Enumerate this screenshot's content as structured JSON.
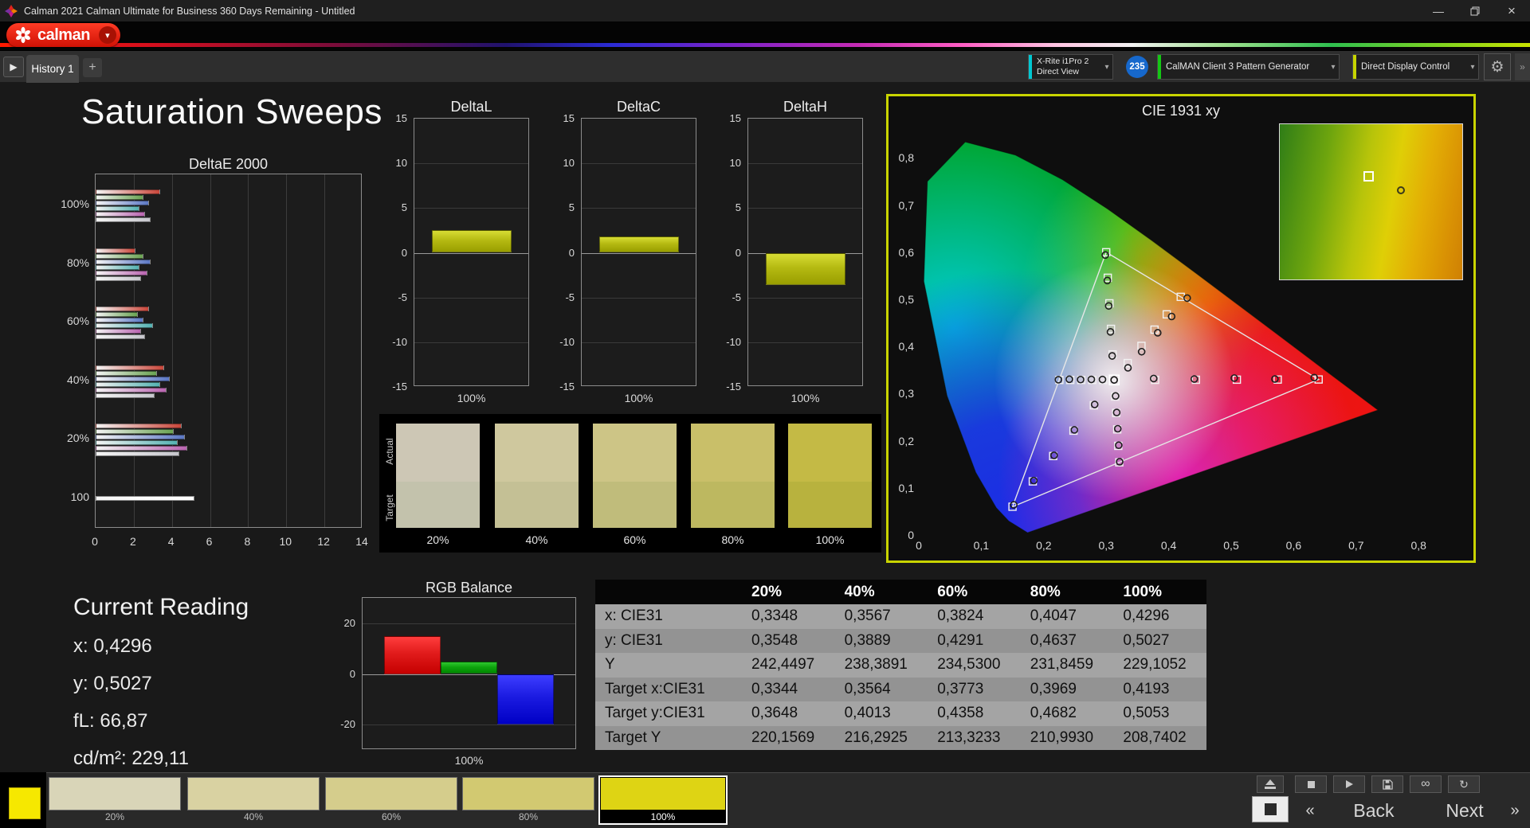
{
  "window": {
    "title": "Calman 2021 Calman Ultimate for Business 360 Days Remaining  - Untitled"
  },
  "brand": {
    "logo_text": "calman"
  },
  "tabs": {
    "history_tab": "History 1",
    "add_tab": "+"
  },
  "toolbar": {
    "meter_line1": "X-Rite i1Pro 2",
    "meter_line2": "Direct View",
    "meter_badge": "235",
    "source": "CalMAN Client 3 Pattern Generator",
    "display_control": "Direct Display Control"
  },
  "page": {
    "title": "Saturation Sweeps"
  },
  "current_reading": {
    "heading": "Current Reading",
    "x": "x: 0,4296",
    "y": "y: 0,5027",
    "fl": "fL: 66,87",
    "cdm2": "cd/m²: 229,11"
  },
  "swatch_panel": {
    "actual_label": "Actual",
    "target_label": "Target",
    "columns": [
      {
        "label": "20%",
        "actual": "#cdc7b5",
        "target": "#c3c2ac"
      },
      {
        "label": "40%",
        "actual": "#cfc89e",
        "target": "#c4c095"
      },
      {
        "label": "60%",
        "actual": "#cdc586",
        "target": "#c0bc7b"
      },
      {
        "label": "80%",
        "actual": "#c9bf69",
        "target": "#bdb860"
      },
      {
        "label": "100%",
        "actual": "#c4ba45",
        "target": "#b8b23e"
      }
    ]
  },
  "table": {
    "col_headers": [
      "20%",
      "40%",
      "60%",
      "80%",
      "100%"
    ],
    "rows": [
      {
        "label": "x: CIE31",
        "values": [
          "0,3348",
          "0,3567",
          "0,3824",
          "0,4047",
          "0,4296"
        ]
      },
      {
        "label": "y: CIE31",
        "values": [
          "0,3548",
          "0,3889",
          "0,4291",
          "0,4637",
          "0,5027"
        ]
      },
      {
        "label": "Y",
        "values": [
          "242,4497",
          "238,3891",
          "234,5300",
          "231,8459",
          "229,1052"
        ]
      },
      {
        "label": "Target x:CIE31",
        "values": [
          "0,3344",
          "0,3564",
          "0,3773",
          "0,3969",
          "0,4193"
        ]
      },
      {
        "label": "Target y:CIE31",
        "values": [
          "0,3648",
          "0,4013",
          "0,4358",
          "0,4682",
          "0,5053"
        ]
      },
      {
        "label": "Target Y",
        "values": [
          "220,1569",
          "216,2925",
          "213,3233",
          "210,9930",
          "208,7402"
        ]
      }
    ]
  },
  "bottom_bar": {
    "pattern_color": "#f6e800",
    "swatches": [
      {
        "label": "20%",
        "color": "#d9d5b8"
      },
      {
        "label": "40%",
        "color": "#d9d2a2"
      },
      {
        "label": "60%",
        "color": "#d5cd8c"
      },
      {
        "label": "80%",
        "color": "#d2c971"
      },
      {
        "label": "100%",
        "color": "#ded414"
      }
    ],
    "selected_index": 4,
    "back": "Back",
    "next": "Next"
  },
  "icons": {
    "app": "pinwheel-svg",
    "logo_flower": "flower-svg",
    "dropdown_caret": "▾",
    "minimize": "—",
    "maximize": "restore-squares-svg",
    "close": "×",
    "history_play": "▶",
    "add": "+",
    "gear": "⚙",
    "panel_expand": "»",
    "eject": "css-shape",
    "stop": "css-shape",
    "play": "css-shape",
    "save": "floppy-svg",
    "infinity": "∞",
    "repeat": "↻",
    "prev_chevrons": "«",
    "next_chevrons": "»"
  },
  "chart_data": [
    {
      "id": "deltae2000",
      "type": "bar",
      "orientation": "horizontal",
      "title": "DeltaE 2000",
      "categories": [
        "100%",
        "80%",
        "60%",
        "40%",
        "20%",
        "100"
      ],
      "colors": [
        "#c9463a",
        "#6aa352",
        "#5b77c4",
        "#54b2b2",
        "#b964b0",
        "#c6c6cc"
      ],
      "groups": [
        [
          3.4,
          2.5,
          2.8,
          2.3,
          2.6,
          2.9
        ],
        [
          2.1,
          2.5,
          2.9,
          2.3,
          2.7,
          2.4
        ],
        [
          2.8,
          2.2,
          2.5,
          3.0,
          2.4,
          2.6
        ],
        [
          3.6,
          3.2,
          3.9,
          3.4,
          3.7,
          3.1
        ],
        [
          4.5,
          4.1,
          4.7,
          4.3,
          4.8,
          4.4
        ],
        [
          5.2
        ]
      ],
      "xlim": [
        0,
        14
      ],
      "xticks": [
        0,
        2,
        4,
        6,
        8,
        10,
        12,
        14
      ],
      "grid": true
    },
    {
      "id": "deltaL",
      "type": "bar",
      "title": "DeltaL",
      "categories": [
        "100%"
      ],
      "values": [
        2.5
      ],
      "ylim": [
        -15,
        15
      ],
      "yticks": [
        15,
        10,
        5,
        0,
        -5,
        -10,
        -15
      ],
      "bar_color": "#b5ba12",
      "xlabel": "100%"
    },
    {
      "id": "deltaC",
      "type": "bar",
      "title": "DeltaC",
      "categories": [
        "100%"
      ],
      "values": [
        1.8
      ],
      "ylim": [
        -15,
        15
      ],
      "yticks": [
        15,
        10,
        5,
        0,
        -5,
        -10,
        -15
      ],
      "bar_color": "#b5ba12",
      "xlabel": "100%"
    },
    {
      "id": "deltaH",
      "type": "bar",
      "title": "DeltaH",
      "categories": [
        "100%"
      ],
      "values": [
        -3.6
      ],
      "ylim": [
        -15,
        15
      ],
      "yticks": [
        15,
        10,
        5,
        0,
        -5,
        -10,
        -15
      ],
      "bar_color": "#b5ba12",
      "xlabel": "100%"
    },
    {
      "id": "rgb_balance",
      "type": "bar",
      "title": "RGB Balance",
      "categories": [
        "Red",
        "Green",
        "Blue"
      ],
      "values": [
        15,
        5,
        -20
      ],
      "colors": [
        "#e11b1b",
        "#0ea50e",
        "#1b1be1"
      ],
      "ylim": [
        -30,
        30
      ],
      "yticks": [
        20,
        0,
        -20
      ],
      "xlabel": "100%"
    },
    {
      "id": "cie1931",
      "type": "scatter",
      "title": "CIE 1931 xy",
      "xlim": [
        0,
        0.8
      ],
      "ylim": [
        0,
        0.8
      ],
      "xtick_labels": [
        "0",
        "0,1",
        "0,2",
        "0,3",
        "0,4",
        "0,5",
        "0,6",
        "0,7",
        "0,8"
      ],
      "ytick_labels": [
        "0",
        "0,1",
        "0,2",
        "0,3",
        "0,4",
        "0,5",
        "0,6",
        "0,7",
        "0,8"
      ],
      "gamut_triangle": {
        "red": [
          0.64,
          0.33
        ],
        "green": [
          0.3,
          0.6
        ],
        "blue": [
          0.15,
          0.06
        ]
      },
      "white_point": [
        0.3127,
        0.329
      ],
      "sweeps": [
        {
          "name": "red",
          "target": [
            [
              0.3782,
              0.3292
            ],
            [
              0.4436,
              0.3294
            ],
            [
              0.5091,
              0.3296
            ],
            [
              0.5745,
              0.3298
            ],
            [
              0.64,
              0.33
            ]
          ],
          "measured": [
            [
              0.376,
              0.332
            ],
            [
              0.441,
              0.331
            ],
            [
              0.505,
              0.333
            ],
            [
              0.57,
              0.331
            ],
            [
              0.633,
              0.334
            ]
          ]
        },
        {
          "name": "green",
          "target": [
            [
              0.3102,
              0.3832
            ],
            [
              0.3076,
              0.4374
            ],
            [
              0.3051,
              0.4916
            ],
            [
              0.3025,
              0.5458
            ],
            [
              0.3,
              0.6
            ]
          ],
          "measured": [
            [
              0.3095,
              0.38
            ],
            [
              0.3068,
              0.431
            ],
            [
              0.304,
              0.486
            ],
            [
              0.3018,
              0.54
            ],
            [
              0.2985,
              0.594
            ]
          ]
        },
        {
          "name": "blue",
          "target": [
            [
              0.2802,
              0.2752
            ],
            [
              0.2476,
              0.2214
            ],
            [
              0.2151,
              0.1676
            ],
            [
              0.1825,
              0.1138
            ],
            [
              0.15,
              0.06
            ]
          ],
          "measured": [
            [
              0.2815,
              0.277
            ],
            [
              0.249,
              0.223
            ],
            [
              0.2165,
              0.169
            ],
            [
              0.184,
              0.1155
            ],
            [
              0.152,
              0.064
            ]
          ]
        },
        {
          "name": "cyan",
          "target": [
            [
              0.2952,
              0.329
            ],
            [
              0.2776,
              0.329
            ],
            [
              0.2601,
              0.329
            ],
            [
              0.2425,
              0.329
            ],
            [
              0.225,
              0.329
            ]
          ],
          "measured": [
            [
              0.294,
              0.33
            ],
            [
              0.2762,
              0.3302
            ],
            [
              0.259,
              0.3298
            ],
            [
              0.241,
              0.3305
            ],
            [
              0.2235,
              0.3295
            ]
          ]
        },
        {
          "name": "magenta",
          "target": [
            [
              0.3143,
              0.294
            ],
            [
              0.316,
              0.2591
            ],
            [
              0.3176,
              0.2241
            ],
            [
              0.3193,
              0.1892
            ],
            [
              0.3209,
              0.1542
            ]
          ],
          "measured": [
            [
              0.315,
              0.295
            ],
            [
              0.3168,
              0.26
            ],
            [
              0.3185,
              0.2255
            ],
            [
              0.32,
              0.1905
            ],
            [
              0.3215,
              0.1555
            ]
          ]
        },
        {
          "name": "yellow",
          "target": [
            [
              0.3344,
              0.3648
            ],
            [
              0.3564,
              0.4013
            ],
            [
              0.3773,
              0.4358
            ],
            [
              0.3969,
              0.4682
            ],
            [
              0.4193,
              0.5053
            ]
          ],
          "measured": [
            [
              0.3348,
              0.3548
            ],
            [
              0.3567,
              0.3889
            ],
            [
              0.3824,
              0.4291
            ],
            [
              0.4047,
              0.4637
            ],
            [
              0.4296,
              0.5027
            ]
          ]
        }
      ]
    }
  ]
}
